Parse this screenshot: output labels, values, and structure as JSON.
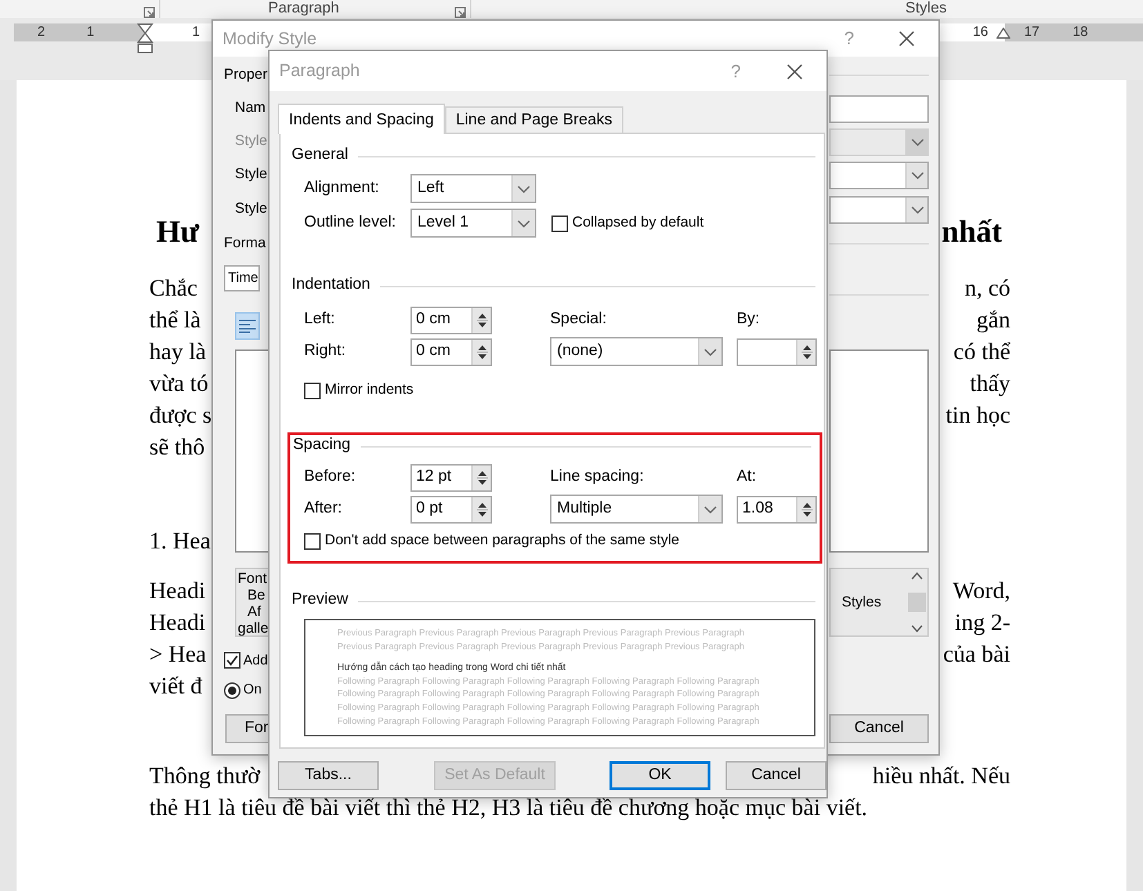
{
  "ribbon": {
    "groups": [
      {
        "label": "Paragraph"
      },
      {
        "label": "Styles"
      }
    ]
  },
  "ruler": {
    "left_numbers": [
      "2",
      "1",
      "1"
    ],
    "right_numbers": [
      "16",
      "17",
      "18"
    ]
  },
  "document": {
    "blocks": [
      {
        "kind": "heading",
        "lines": [
          {
            "left": "Hư",
            "right": "nhất"
          }
        ]
      },
      {
        "kind": "paragraph",
        "lines": [
          {
            "left": "Chắc",
            "right": "n, có"
          },
          {
            "left": "thể là",
            "right": "gắn"
          },
          {
            "left": "hay là",
            "right": "có thể"
          },
          {
            "left": "vừa tó",
            "right": "thấy"
          },
          {
            "left": "được s",
            "right": "tin học"
          },
          {
            "left": "sẽ thô"
          }
        ]
      },
      {
        "kind": "subheading",
        "lines": [
          {
            "left": "1. Hea"
          }
        ]
      },
      {
        "kind": "paragraph",
        "lines": [
          {
            "left": "Headi",
            "right": "Word,"
          },
          {
            "left": "Headi",
            "right": "ing 2-"
          },
          {
            "left": "> Hea",
            "right": "của bài"
          },
          {
            "left": "viết đ"
          }
        ]
      },
      {
        "kind": "paragraph",
        "lines": [
          {
            "left": "Thông thườ",
            "right": "hiều nhất. Nếu"
          },
          {
            "left": "thẻ H1 là tiêu đề bài viết thì thẻ H2, H3 là tiêu đề chương hoặc mục bài viết."
          }
        ]
      }
    ]
  },
  "modify_style": {
    "title": "Modify Style",
    "help": "?",
    "labels": [
      {
        "text": "Proper",
        "disabled": false
      },
      {
        "text": "Nam",
        "disabled": false
      },
      {
        "text": "Style",
        "disabled": true
      },
      {
        "text": "Style",
        "disabled": false
      },
      {
        "text": "Style",
        "disabled": false
      },
      {
        "text": "Forma",
        "disabled": false
      }
    ],
    "fields": [
      {
        "kind": "input",
        "disabled": false
      },
      {
        "kind": "dropdown",
        "disabled": true
      },
      {
        "kind": "dropdown",
        "disabled": false
      },
      {
        "kind": "dropdown",
        "disabled": false
      }
    ],
    "font_field": "Time",
    "description": {
      "lines": [
        "Font",
        "Be",
        "Af",
        "galle"
      ],
      "right": "Styles"
    },
    "add_to_gallery": {
      "label": "Add",
      "checked": true
    },
    "radio": {
      "label": "On",
      "selected": true
    },
    "buttons": [
      {
        "label": "For"
      },
      {
        "label": "Cancel"
      }
    ]
  },
  "paragraph": {
    "title": "Paragraph",
    "help": "?",
    "tabs": [
      {
        "label": "Indents and Spacing",
        "selected": true
      },
      {
        "label": "Line and Page Breaks",
        "selected": false
      }
    ],
    "general": {
      "title": "General",
      "alignment": {
        "label": "Alignment:",
        "value": "Left"
      },
      "outline_level": {
        "label": "Outline level:",
        "value": "Level 1"
      },
      "collapsed": {
        "label": "Collapsed by default",
        "checked": false
      }
    },
    "indentation": {
      "title": "Indentation",
      "left": {
        "label": "Left:",
        "value": "0 cm"
      },
      "right": {
        "label": "Right:",
        "value": "0 cm"
      },
      "special": {
        "label": "Special:",
        "value": "(none)"
      },
      "by": {
        "label": "By:"
      },
      "mirror": {
        "label": "Mirror indents",
        "checked": false
      }
    },
    "spacing": {
      "title": "Spacing",
      "highlighted": true,
      "before": {
        "label": "Before:",
        "value": "12 pt"
      },
      "after": {
        "label": "After:",
        "value": "0 pt"
      },
      "line_spacing": {
        "label": "Line spacing:",
        "value": "Multiple"
      },
      "at": {
        "label": "At:",
        "value": "1.08"
      },
      "dont_add": {
        "label": "Don't add space between paragraphs of the same style",
        "checked": false
      }
    },
    "preview": {
      "title": "Preview",
      "previous_lines": [
        "Previous Paragraph Previous Paragraph Previous Paragraph Previous Paragraph Previous Paragraph",
        "Previous Paragraph Previous Paragraph Previous Paragraph Previous Paragraph Previous Paragraph"
      ],
      "current": "Hướng dẫn cách tạo heading trong Word chi tiết nhất",
      "following_lines": [
        "Following Paragraph Following Paragraph Following Paragraph Following Paragraph Following Paragraph",
        "Following Paragraph Following Paragraph Following Paragraph Following Paragraph Following Paragraph",
        "Following Paragraph Following Paragraph Following Paragraph Following Paragraph Following Paragraph",
        "Following Paragraph Following Paragraph Following Paragraph Following Paragraph Following Paragraph"
      ]
    },
    "buttons": [
      {
        "label": "Tabs...",
        "disabled": false,
        "default": false
      },
      {
        "label": "Set As Default",
        "disabled": true,
        "default": false
      },
      {
        "label": "OK",
        "disabled": false,
        "default": true
      },
      {
        "label": "Cancel",
        "disabled": false,
        "default": false
      }
    ]
  }
}
